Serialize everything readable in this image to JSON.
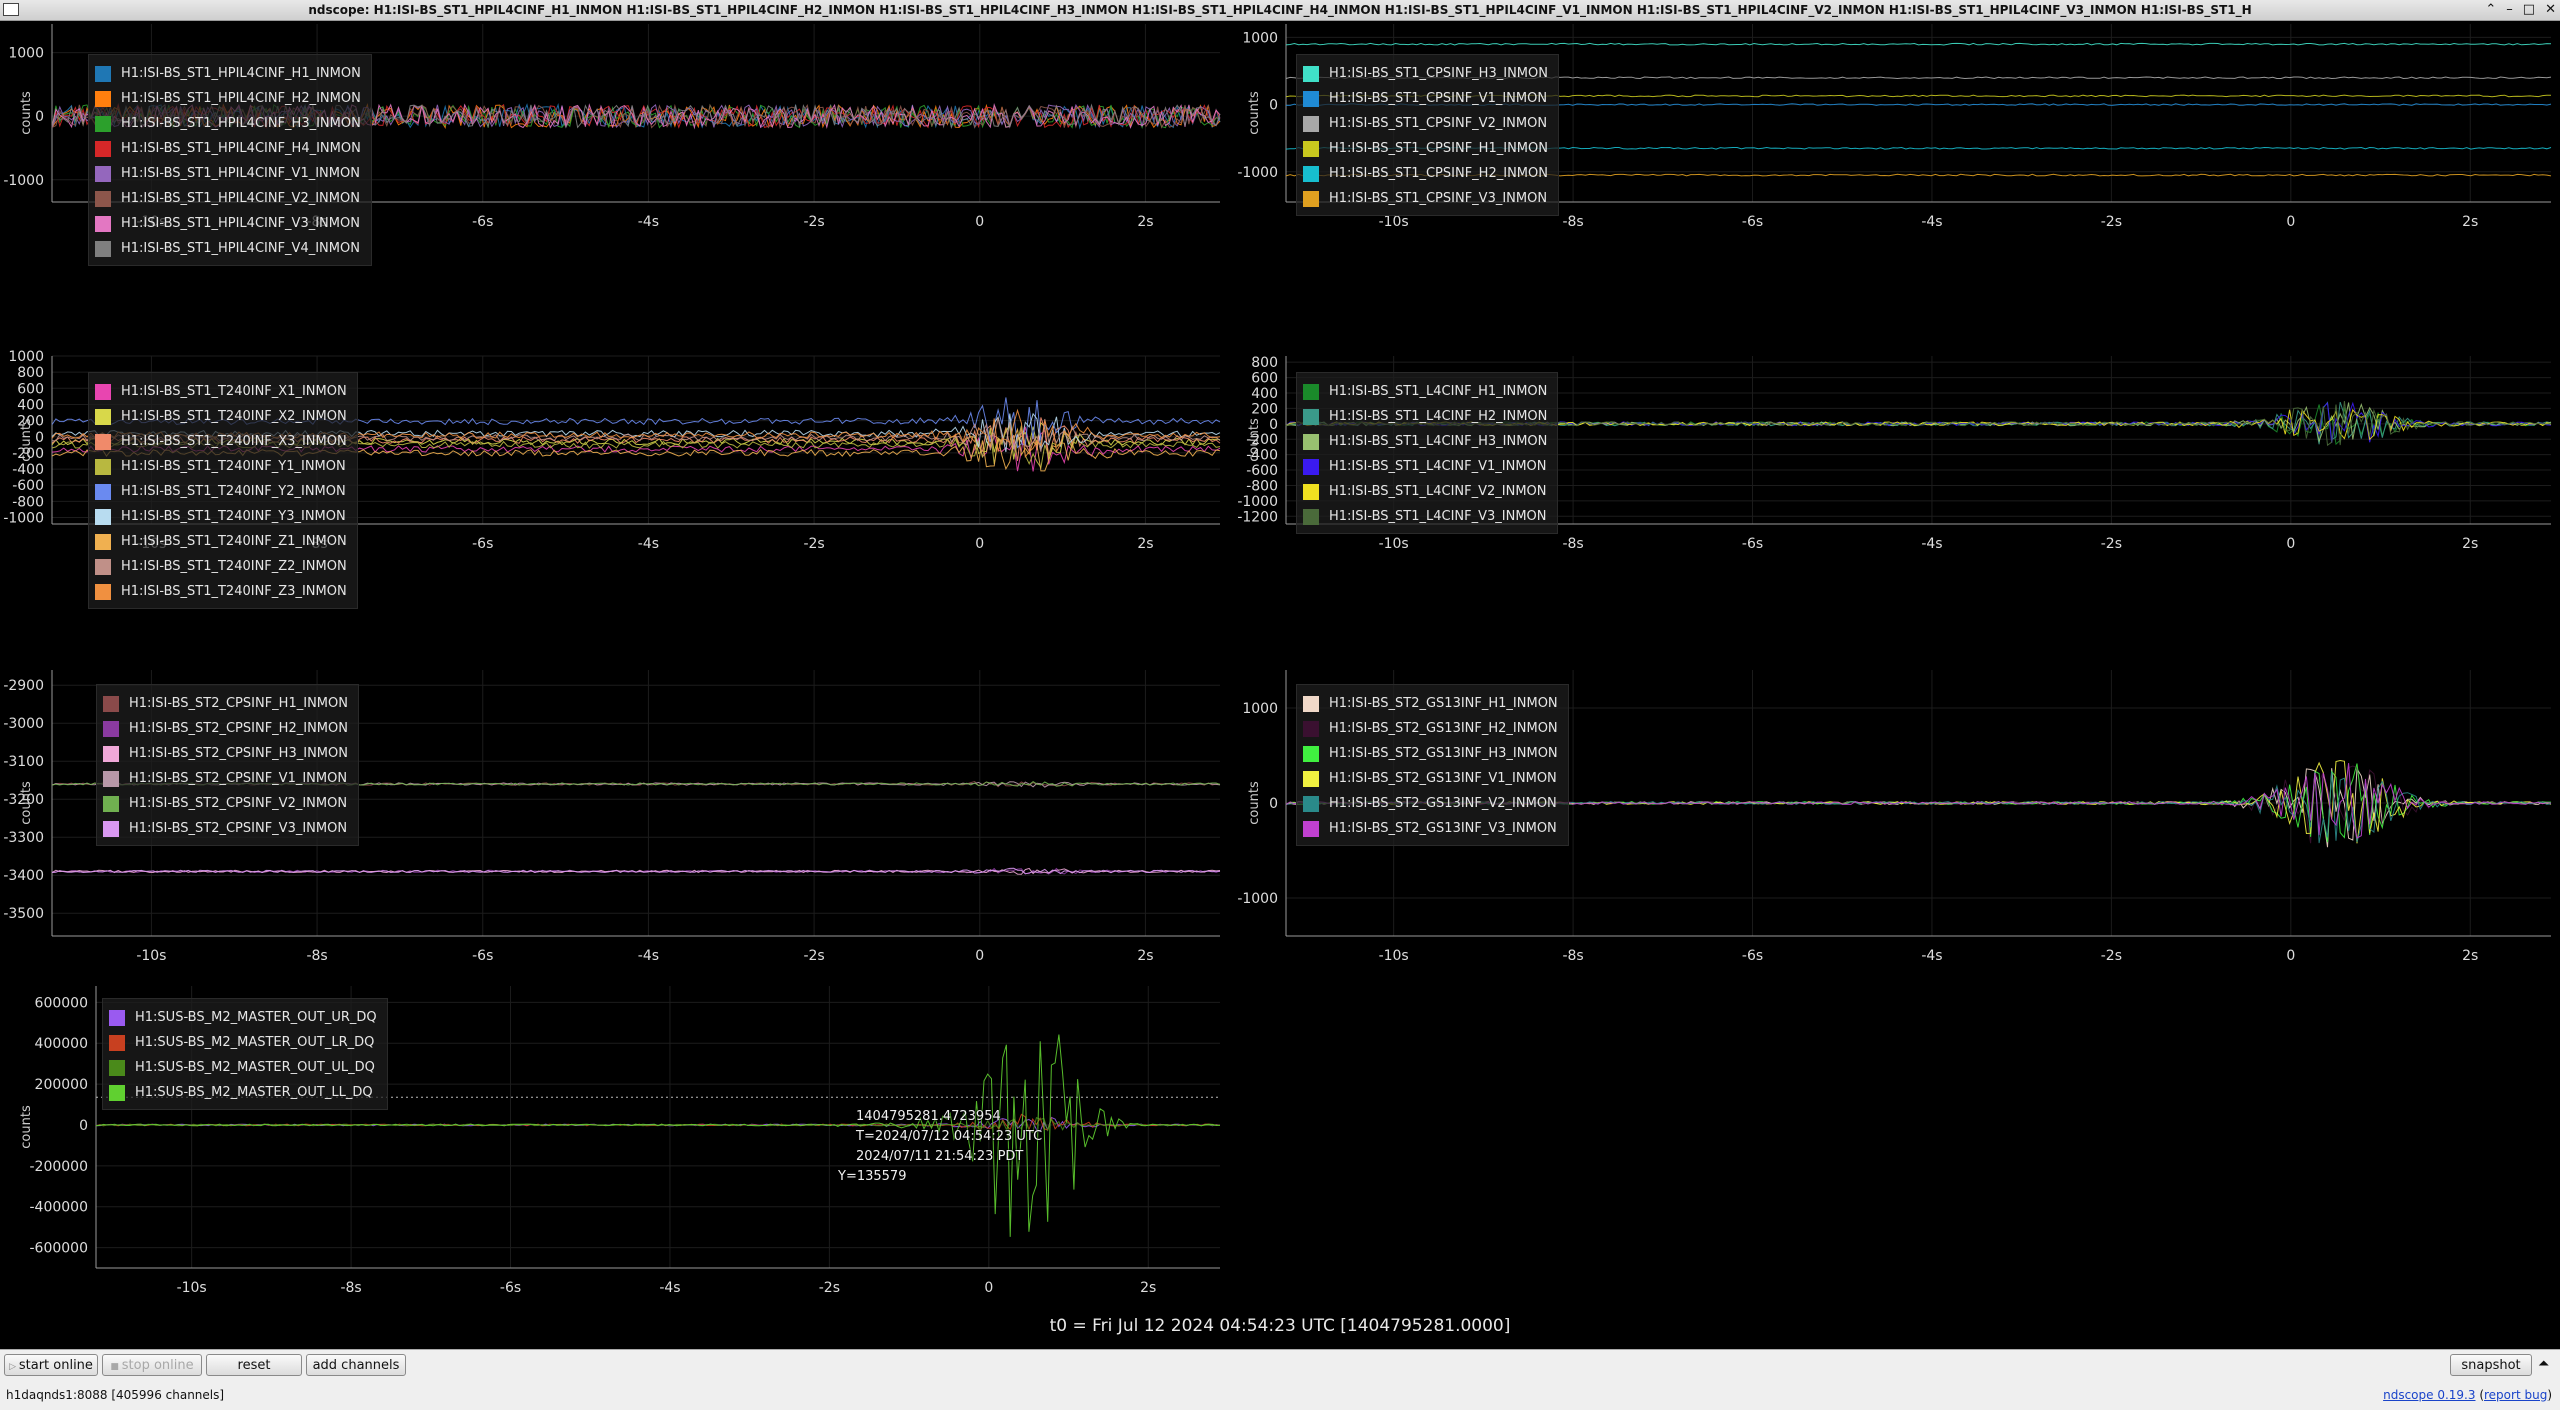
{
  "window": {
    "title": "ndscope: H1:ISI-BS_ST1_HPIL4CINF_H1_INMON H1:ISI-BS_ST1_HPIL4CINF_H2_INMON H1:ISI-BS_ST1_HPIL4CINF_H3_INMON H1:ISI-BS_ST1_HPIL4CINF_H4_INMON H1:ISI-BS_ST1_HPIL4CINF_V1_INMON H1:ISI-BS_ST1_HPIL4CINF_V2_INMON H1:ISI-BS_ST1_HPIL4CINF_V3_INMON H1:ISI-BS_ST1_H",
    "controls": [
      "⌃",
      "–",
      "□",
      "✕"
    ]
  },
  "xaxis": {
    "ticks": [
      -10,
      -8,
      -6,
      -4,
      -2,
      0,
      2
    ],
    "tick_labels": [
      "-10s",
      "-8s",
      "-6s",
      "-4s",
      "-2s",
      "0",
      "2s"
    ],
    "range": [
      -11.2,
      2.9
    ]
  },
  "plots": [
    {
      "id": "p1",
      "ylabel": "counts",
      "yticks": [
        1000,
        0,
        -1000
      ],
      "ylim": [
        -1350,
        1450
      ],
      "legend": [
        {
          "name": "H1:ISI-BS_ST1_HPIL4CINF_H1_INMON",
          "color": "#1f77b4"
        },
        {
          "name": "H1:ISI-BS_ST1_HPIL4CINF_H2_INMON",
          "color": "#ff7f0e"
        },
        {
          "name": "H1:ISI-BS_ST1_HPIL4CINF_H3_INMON",
          "color": "#2ca02c"
        },
        {
          "name": "H1:ISI-BS_ST1_HPIL4CINF_H4_INMON",
          "color": "#d62728"
        },
        {
          "name": "H1:ISI-BS_ST1_HPIL4CINF_V1_INMON",
          "color": "#9467bd"
        },
        {
          "name": "H1:ISI-BS_ST1_HPIL4CINF_V2_INMON",
          "color": "#8c564b"
        },
        {
          "name": "H1:ISI-BS_ST1_HPIL4CINF_V3_INMON",
          "color": "#e377c2"
        },
        {
          "name": "H1:ISI-BS_ST1_HPIL4CINF_V4_INMON",
          "color": "#7f7f7f"
        }
      ]
    },
    {
      "id": "p2",
      "ylabel": "counts",
      "yticks": [
        1000,
        0,
        -1000
      ],
      "ylim": [
        -1450,
        1200
      ],
      "legend": [
        {
          "name": "H1:ISI-BS_ST1_CPSINF_H3_INMON",
          "color": "#40e0c8"
        },
        {
          "name": "H1:ISI-BS_ST1_CPSINF_V1_INMON",
          "color": "#1f8ad4"
        },
        {
          "name": "H1:ISI-BS_ST1_CPSINF_V2_INMON",
          "color": "#a8a8a8"
        },
        {
          "name": "H1:ISI-BS_ST1_CPSINF_H1_INMON",
          "color": "#c8c81e"
        },
        {
          "name": "H1:ISI-BS_ST1_CPSINF_H2_INMON",
          "color": "#17becf"
        },
        {
          "name": "H1:ISI-BS_ST1_CPSINF_V3_INMON",
          "color": "#e0a020"
        }
      ]
    },
    {
      "id": "p3",
      "ylabel": "counts",
      "yticks": [
        1000,
        800,
        600,
        400,
        200,
        0,
        -200,
        -400,
        -600,
        -800,
        -1000
      ],
      "ylim": [
        -1080,
        1000
      ],
      "legend": [
        {
          "name": "H1:ISI-BS_ST1_T240INF_X1_INMON",
          "color": "#e845b0"
        },
        {
          "name": "H1:ISI-BS_ST1_T240INF_X2_INMON",
          "color": "#d8d84a"
        },
        {
          "name": "H1:ISI-BS_ST1_T240INF_X3_INMON",
          "color": "#f08a6a"
        },
        {
          "name": "H1:ISI-BS_ST1_T240INF_Y1_INMON",
          "color": "#b8b840"
        },
        {
          "name": "H1:ISI-BS_ST1_T240INF_Y2_INMON",
          "color": "#6a8af0"
        },
        {
          "name": "H1:ISI-BS_ST1_T240INF_Y3_INMON",
          "color": "#b8dcf0"
        },
        {
          "name": "H1:ISI-BS_ST1_T240INF_Z1_INMON",
          "color": "#f0b050"
        },
        {
          "name": "H1:ISI-BS_ST1_T240INF_Z2_INMON",
          "color": "#c09088"
        },
        {
          "name": "H1:ISI-BS_ST1_T240INF_Z3_INMON",
          "color": "#f09040"
        }
      ]
    },
    {
      "id": "p4",
      "ylabel": "counts",
      "yticks": [
        800,
        600,
        400,
        200,
        0,
        -200,
        -400,
        -600,
        -800,
        -1000,
        -1200
      ],
      "ylim": [
        -1300,
        880
      ],
      "legend": [
        {
          "name": "H1:ISI-BS_ST1_L4CINF_H1_INMON",
          "color": "#1a8a2a"
        },
        {
          "name": "H1:ISI-BS_ST1_L4CINF_H2_INMON",
          "color": "#3a9a8a"
        },
        {
          "name": "H1:ISI-BS_ST1_L4CINF_H3_INMON",
          "color": "#98c070"
        },
        {
          "name": "H1:ISI-BS_ST1_L4CINF_V1_INMON",
          "color": "#3a1af0"
        },
        {
          "name": "H1:ISI-BS_ST1_L4CINF_V2_INMON",
          "color": "#f0e020"
        },
        {
          "name": "H1:ISI-BS_ST1_L4CINF_V3_INMON",
          "color": "#4a6a3a"
        }
      ]
    },
    {
      "id": "p5",
      "ylabel": "counts",
      "yticks": [
        -2900,
        -3000,
        -3100,
        -3200,
        -3300,
        -3400,
        -3500
      ],
      "ylim": [
        -3560,
        -2860
      ],
      "legend": [
        {
          "name": "H1:ISI-BS_ST2_CPSINF_H1_INMON",
          "color": "#8a4a4a"
        },
        {
          "name": "H1:ISI-BS_ST2_CPSINF_H2_INMON",
          "color": "#8a3aa0"
        },
        {
          "name": "H1:ISI-BS_ST2_CPSINF_H3_INMON",
          "color": "#f0a8d8"
        },
        {
          "name": "H1:ISI-BS_ST2_CPSINF_V1_INMON",
          "color": "#b898a8"
        },
        {
          "name": "H1:ISI-BS_ST2_CPSINF_V2_INMON",
          "color": "#70b050"
        },
        {
          "name": "H1:ISI-BS_ST2_CPSINF_V3_INMON",
          "color": "#d898f0"
        }
      ]
    },
    {
      "id": "p6",
      "ylabel": "counts",
      "yticks": [
        1000,
        0,
        -1000
      ],
      "ylim": [
        -1400,
        1400
      ],
      "legend": [
        {
          "name": "H1:ISI-BS_ST2_GS13INF_H1_INMON",
          "color": "#f0d8c8"
        },
        {
          "name": "H1:ISI-BS_ST2_GS13INF_H2_INMON",
          "color": "#3a1030"
        },
        {
          "name": "H1:ISI-BS_ST2_GS13INF_H3_INMON",
          "color": "#40f040"
        },
        {
          "name": "H1:ISI-BS_ST2_GS13INF_V1_INMON",
          "color": "#f0f040"
        },
        {
          "name": "H1:ISI-BS_ST2_GS13INF_V2_INMON",
          "color": "#2a8a8a"
        },
        {
          "name": "H1:ISI-BS_ST2_GS13INF_V3_INMON",
          "color": "#c040d0"
        }
      ]
    },
    {
      "id": "p7",
      "ylabel": "counts",
      "yticks": [
        600000,
        400000,
        200000,
        0,
        -200000,
        -400000,
        -600000
      ],
      "ylim": [
        -700000,
        680000
      ],
      "legend": [
        {
          "name": "H1:SUS-BS_M2_MASTER_OUT_UR_DQ",
          "color": "#9a5af0"
        },
        {
          "name": "H1:SUS-BS_M2_MASTER_OUT_LR_DQ",
          "color": "#c84020"
        },
        {
          "name": "H1:SUS-BS_M2_MASTER_OUT_UL_DQ",
          "color": "#4a8a1a"
        },
        {
          "name": "H1:SUS-BS_M2_MASTER_OUT_LL_DQ",
          "color": "#60d030"
        }
      ],
      "cursor": {
        "line1": "1404795281.4723954",
        "line2": "T=2024/07/12 04:54:23 UTC",
        "line3": "2024/07/11 21:54:23 PDT",
        "line4": "Y=135579",
        "t": 0.47,
        "y": 135579
      }
    }
  ],
  "t0_label": "t0 = Fri Jul 12 2024 04:54:23 UTC [1404795281.0000]",
  "toolbar": {
    "start_online": "start online",
    "stop_online": "stop online",
    "reset": "reset",
    "add_channels": "add channels",
    "snapshot": "snapshot",
    "expand": "⏶"
  },
  "status": {
    "server": "h1daqnds1:8088  [405996 channels]",
    "version_link": "ndscope 0.19.3",
    "report_link": "report bug"
  }
}
